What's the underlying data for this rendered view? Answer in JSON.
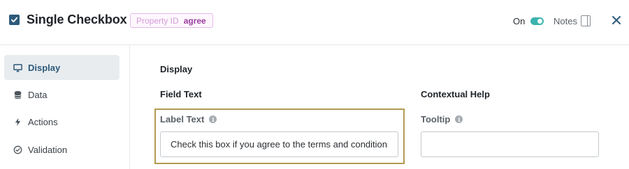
{
  "header": {
    "title": "Single Checkbox",
    "property_id_key": "Property ID",
    "property_id_value": "agree",
    "on_label": "On",
    "toggle_on": true,
    "notes_label": "Notes"
  },
  "sidebar": {
    "items": [
      {
        "label": "Display",
        "icon": "monitor-icon",
        "active": true
      },
      {
        "label": "Data",
        "icon": "database-icon",
        "active": false
      },
      {
        "label": "Actions",
        "icon": "lightning-icon",
        "active": false
      },
      {
        "label": "Validation",
        "icon": "check-circle-icon",
        "active": false
      }
    ]
  },
  "main": {
    "section_title": "Display",
    "field_text_heading": "Field Text",
    "contextual_help_heading": "Contextual Help",
    "label_text": {
      "label": "Label Text",
      "value": "Check this box if you agree to the terms and conditions."
    },
    "tooltip": {
      "label": "Tooltip",
      "value": ""
    }
  },
  "colors": {
    "brand": "#2d5a7a",
    "toggle_on": "#3bb3b0",
    "badge_border": "#e4b9e9",
    "badge_value": "#9a3c9e",
    "highlight_border": "#b39a52"
  }
}
